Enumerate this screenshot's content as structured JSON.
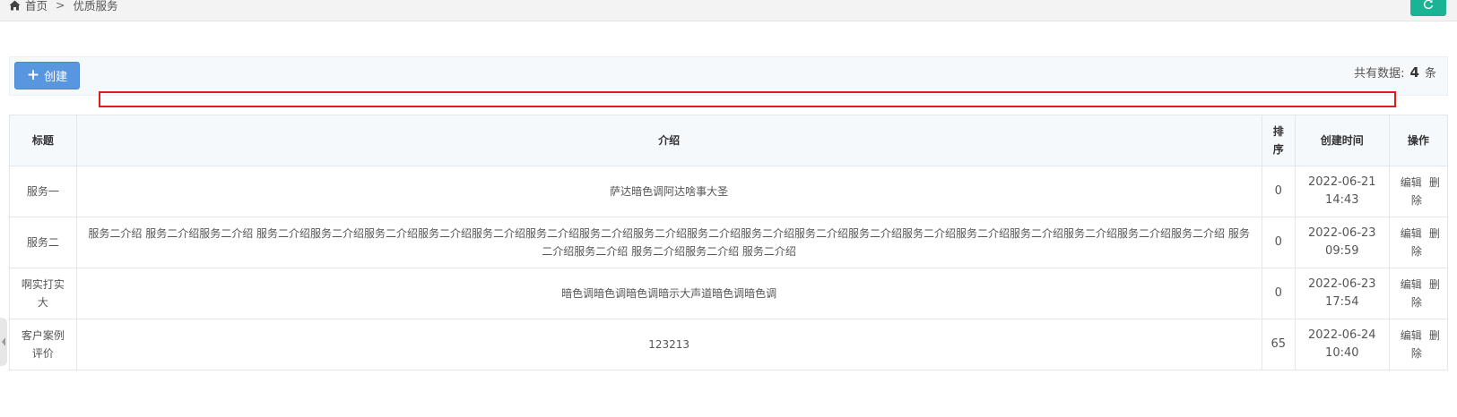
{
  "breadcrumb": {
    "home": "首页",
    "separator": ">",
    "current": "优质服务"
  },
  "toolbar": {
    "create_label": "创建",
    "total_prefix": "共有数据:",
    "total_count": "4",
    "total_suffix": "条"
  },
  "table": {
    "headers": [
      "标题",
      "介绍",
      "排序",
      "创建时间",
      "操作"
    ],
    "rows": [
      {
        "title": "服务一",
        "intro": "萨达暗色调阿达啥事大圣",
        "sort": "0",
        "created": "2022-06-21 14:43",
        "edit": "编辑",
        "delete": "删除"
      },
      {
        "title": "服务二",
        "intro": "服务二介绍 服务二介绍服务二介绍 服务二介绍服务二介绍服务二介绍服务二介绍服务二介绍服务二介绍服务二介绍服务二介绍服务二介绍服务二介绍服务二介绍服务二介绍服务二介绍服务二介绍服务二介绍服务二介绍服务二介绍服务二介绍 服务二介绍服务二介绍 服务二介绍服务二介绍 服务二介绍",
        "sort": "0",
        "created": "2022-06-23 09:59",
        "edit": "编辑",
        "delete": "删除"
      },
      {
        "title": "啊实打实大",
        "intro": "暗色调暗色调暗色调暗示大声道暗色调暗色调",
        "sort": "0",
        "created": "2022-06-23 17:54",
        "edit": "编辑",
        "delete": "删除"
      },
      {
        "title": "客户案例评价",
        "intro": "123213",
        "sort": "65",
        "created": "2022-06-24 10:40",
        "edit": "编辑",
        "delete": "删除"
      }
    ]
  },
  "colors": {
    "create_button": "#5996e0",
    "refresh_button": "#1ab394",
    "highlight_box": "#e01b1b"
  },
  "icons": {
    "home": "home-icon",
    "refresh": "refresh-icon",
    "plus": "plus-icon",
    "side_toggle": "chevron-left-icon"
  }
}
